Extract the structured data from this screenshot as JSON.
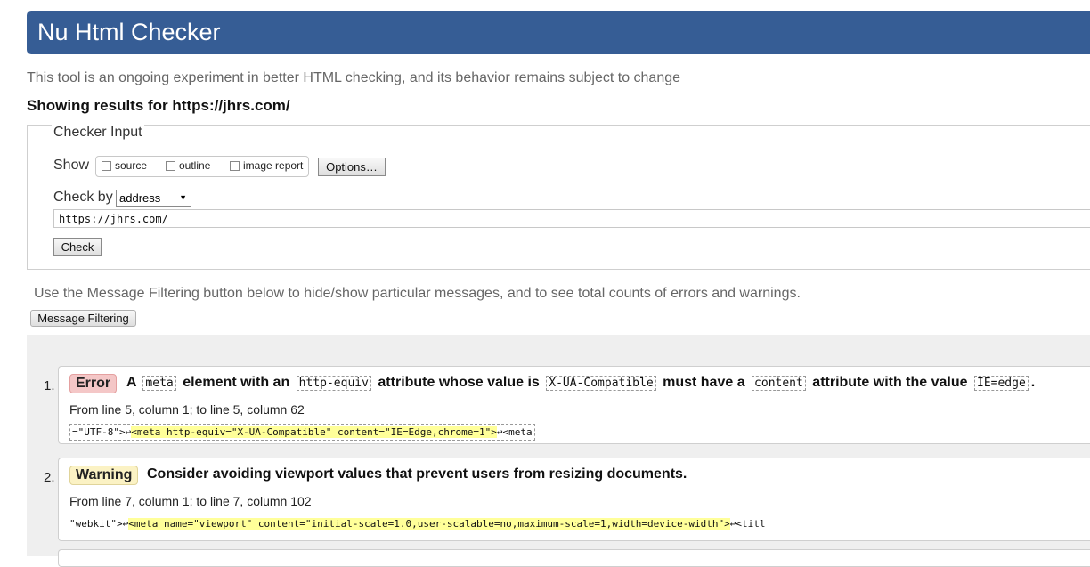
{
  "header": {
    "title": "Nu Html Checker"
  },
  "intro_text": "This tool is an ongoing experiment in better HTML checking, and its behavior remains subject to change",
  "showing_results": "Showing results for https://jhrs.com/",
  "checker_input": {
    "legend": "Checker Input",
    "show_label": "Show",
    "options": [
      {
        "label": "source",
        "checked": false
      },
      {
        "label": "outline",
        "checked": false
      },
      {
        "label": "image report",
        "checked": false
      }
    ],
    "options_button": "Options…",
    "check_by_label": "Check by",
    "check_by_value": "address",
    "url_value": "https://jhrs.com/",
    "check_button": "Check"
  },
  "filter_note": "Use the Message Filtering button below to hide/show particular messages, and to see total counts of errors and warnings.",
  "filter_button": "Message Filtering",
  "messages": [
    {
      "number": "1.",
      "type": "Error",
      "title_parts": [
        "A",
        "meta",
        "element with an",
        "http-equiv",
        "attribute whose value is",
        "X-UA-Compatible",
        "must have a",
        "content",
        "attribute with the value",
        "IE=edge",
        "."
      ],
      "location": "From line 5, column 1; to line 5, column 62",
      "extract_before": "=\"UTF-8\">↩",
      "extract_highlight": "<meta http-equiv=\"X-UA-Compatible\" content=\"IE=Edge,chrome=1\">",
      "extract_after": "↩<meta"
    },
    {
      "number": "2.",
      "type": "Warning",
      "title": "Consider avoiding viewport values that prevent users from resizing documents.",
      "location": "From line 7, column 1; to line 7, column 102",
      "extract_before": "\"webkit\">↩",
      "extract_highlight": "<meta name=\"viewport\" content=\"initial-scale=1.0,user-scalable=no,maximum-scale=1,width=device-width\">",
      "extract_after": "↩<titl"
    }
  ]
}
